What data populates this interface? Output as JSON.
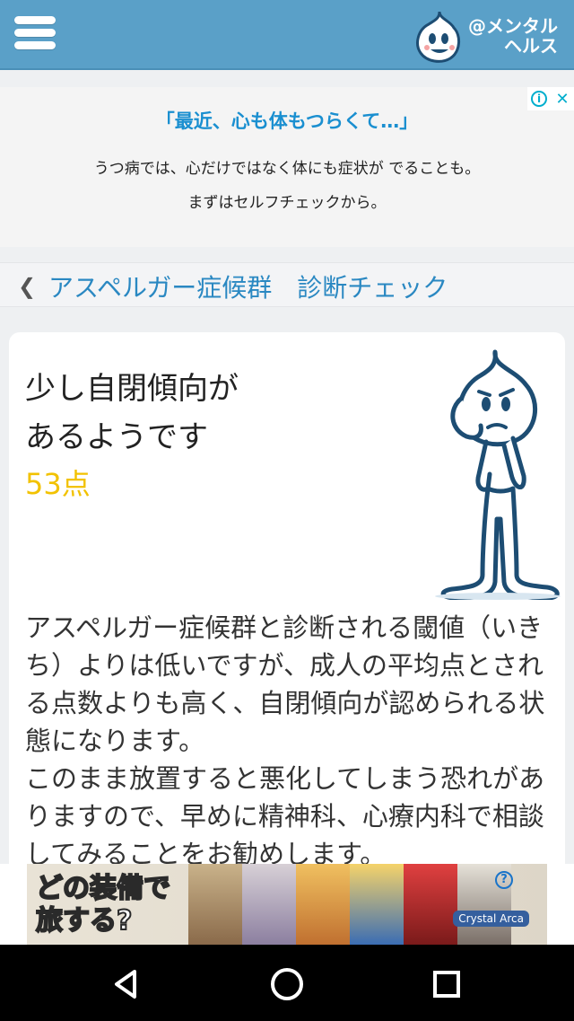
{
  "header": {
    "brand_line1": "@メンタル",
    "brand_line2": "ヘルス",
    "brand_color": "#5aa0c8"
  },
  "ad_top": {
    "headline": "「最近、心も体もつらくて…」",
    "line1": "うつ病では、心だけではなく体にも症状が でることも。",
    "line2": "まずはセルフチェックから。",
    "info_icon": "info-icon",
    "close_icon": "close-icon"
  },
  "breadcrumb": {
    "back_icon": "chevron-left-icon",
    "title": "アスペルガー症候群　診断チェック"
  },
  "result": {
    "title_line1": "少し自閉傾向が",
    "title_line2": "あるようです",
    "score": "53点",
    "score_color": "#f2c200",
    "body": "アスペルガー症候群と診断される閾値（いきち）よりは低いですが、成人の平均点とされる点数よりも高く、自閉傾向が認められる状態になります。\nこのまま放置すると悪化してしまう恐れがありますので、早めに精神科、心療内科で相談してみることをお勧めします。"
  },
  "ad_bottom": {
    "text_line1": "どの装備で",
    "text_line2": "旅する?",
    "logo": "Crystal Arca",
    "help": "?"
  },
  "navbar": {
    "back": "back-icon",
    "home": "home-icon",
    "recents": "recents-icon"
  }
}
